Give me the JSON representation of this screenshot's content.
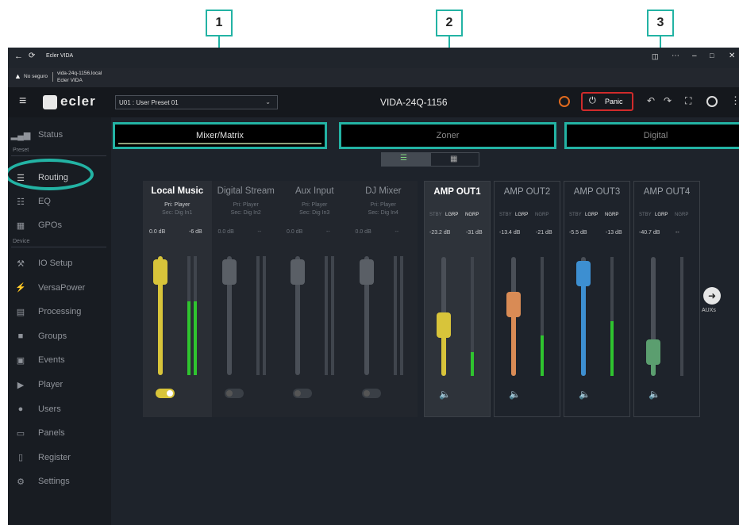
{
  "callouts": [
    "1",
    "2",
    "3"
  ],
  "browser": {
    "tab_title": "Ecler VIDA",
    "insecure_label": "No seguro",
    "address_host": "vida-24q-1156.local",
    "address_sub": "Ecler VIDA"
  },
  "app": {
    "logo_text": "ecler",
    "preset": "U01 : User Preset 01",
    "device_title": "VIDA-24Q-1156",
    "panic_label": "Panic"
  },
  "sidebar": {
    "section_preset": "Preset",
    "section_device": "Device",
    "preset_items": [
      {
        "label": "Status",
        "icon": "bar-chart-icon"
      },
      {
        "label": "Routing",
        "icon": "routing-sign-icon"
      },
      {
        "label": "EQ",
        "icon": "equalizer-icon"
      },
      {
        "label": "GPOs",
        "icon": "gpo-icon"
      }
    ],
    "device_items": [
      {
        "label": "IO Setup",
        "icon": "wrench-icon"
      },
      {
        "label": "VersaPower",
        "icon": "lightning-icon"
      },
      {
        "label": "Processing",
        "icon": "chip-icon"
      },
      {
        "label": "Groups",
        "icon": "speaker-icon"
      },
      {
        "label": "Events",
        "icon": "calendar-icon"
      },
      {
        "label": "Player",
        "icon": "play-icon"
      },
      {
        "label": "Users",
        "icon": "users-icon"
      },
      {
        "label": "Panels",
        "icon": "panel-icon"
      },
      {
        "label": "Register",
        "icon": "document-icon"
      },
      {
        "label": "Settings",
        "icon": "gear-icon"
      }
    ]
  },
  "tabs": [
    "Mixer/Matrix",
    "Zoner",
    "Digital"
  ],
  "inputs": [
    {
      "name": "Local Music",
      "pri": "Pri: Player",
      "sec": "Sec: Dig In1",
      "gain": "0.0 dB",
      "peak": "-6 dB",
      "level": 0.87,
      "meter": 0.62,
      "enabled": true
    },
    {
      "name": "Digital Stream",
      "pri": "Pri: Player",
      "sec": "Sec: Dig In2",
      "gain": "0.0 dB",
      "peak": "--",
      "level": 0.87,
      "meter": 0,
      "enabled": false
    },
    {
      "name": "Aux Input",
      "pri": "Pri: Player",
      "sec": "Sec: Dig In3",
      "gain": "0.0 dB",
      "peak": "--",
      "level": 0.87,
      "meter": 0,
      "enabled": false
    },
    {
      "name": "DJ Mixer",
      "pri": "Pri: Player",
      "sec": "Sec: Dig In4",
      "gain": "0.0 dB",
      "peak": "--",
      "level": 0.87,
      "meter": 0,
      "enabled": false
    }
  ],
  "outputs": [
    {
      "name": "AMP OUT1",
      "gain": "-23.2 dB",
      "peak": "-31 dB",
      "level": 0.43,
      "meter": 0.2,
      "color": "#d8c43a",
      "stby": "STBY",
      "lgrp": "LGRP",
      "ngrp": "NGRP",
      "muted": false
    },
    {
      "name": "AMP OUT2",
      "gain": "-13.4 dB",
      "peak": "-21 dB",
      "level": 0.6,
      "meter": 0.34,
      "color": "#d98b55",
      "stby": "STBY",
      "lgrp": "LGRP",
      "ngrp": "NGRP",
      "muted": false
    },
    {
      "name": "AMP OUT3",
      "gain": "-5.5 dB",
      "peak": "-13 dB",
      "level": 0.86,
      "meter": 0.46,
      "color": "#3d8fd1",
      "stby": "STBY",
      "lgrp": "LGRP",
      "ngrp": "NGRP",
      "muted": false
    },
    {
      "name": "AMP OUT4",
      "gain": "-40.7 dB",
      "peak": "--",
      "level": 0.2,
      "meter": 0,
      "color": "#5b9e6f",
      "stby": "STBY",
      "lgrp": "LGRP",
      "ngrp": "NGRP",
      "muted": true
    }
  ],
  "aux_label": "AUXs",
  "colors": {
    "accent": "#23b3a4",
    "input_active": "#d8c43a",
    "meter": "#2fc42f",
    "mute_active": "#f0a020"
  }
}
